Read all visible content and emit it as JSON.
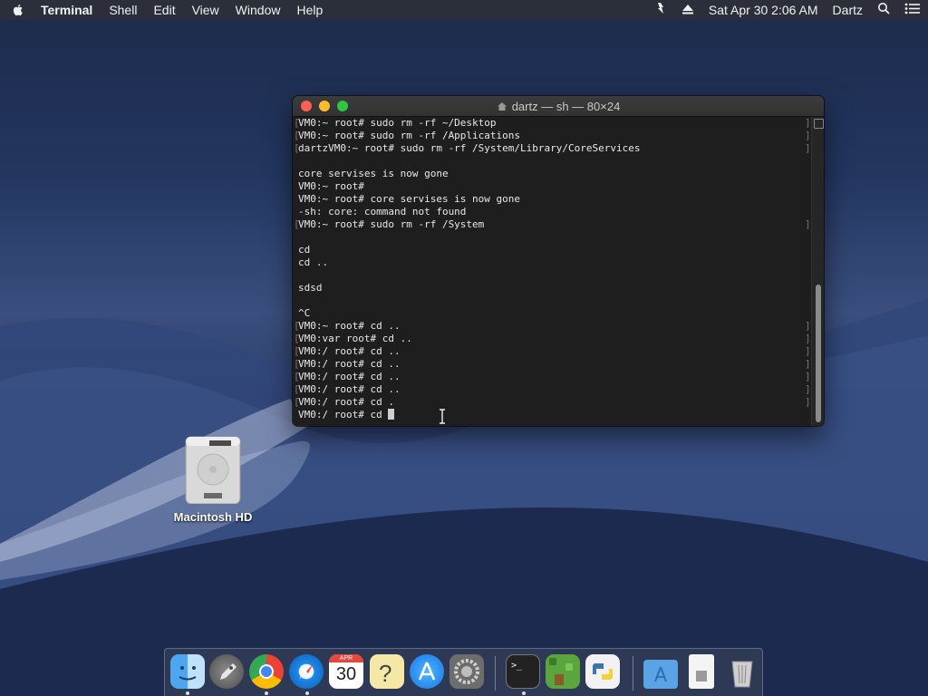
{
  "menubar": {
    "app_name": "Terminal",
    "menus": [
      "Shell",
      "Edit",
      "View",
      "Window",
      "Help"
    ],
    "clock": "Sat Apr 30  2:06 AM",
    "user": "Dartz"
  },
  "window": {
    "title": "dartz — sh — 80×24",
    "lines": [
      {
        "text": "VM0:~ root# sudo rm -rf ~/Desktop",
        "marks": true
      },
      {
        "text": "VM0:~ root# sudo rm -rf /Applications",
        "marks": true
      },
      {
        "text": "dartzVM0:~ root# sudo rm -rf /System/Library/CoreServices",
        "marks": true
      },
      {
        "text": "",
        "marks": false
      },
      {
        "text": "core servises is now gone",
        "marks": false
      },
      {
        "text": "VM0:~ root#",
        "marks": false
      },
      {
        "text": "VM0:~ root# core servises is now gone",
        "marks": false
      },
      {
        "text": "-sh: core: command not found",
        "marks": false
      },
      {
        "text": "VM0:~ root# sudo rm -rf /System",
        "marks": true
      },
      {
        "text": "",
        "marks": false
      },
      {
        "text": "cd",
        "marks": false
      },
      {
        "text": "cd ..",
        "marks": false
      },
      {
        "text": "",
        "marks": false
      },
      {
        "text": "sdsd",
        "marks": false
      },
      {
        "text": "",
        "marks": false
      },
      {
        "text": "^C",
        "marks": false
      },
      {
        "text": "VM0:~ root# cd ..",
        "marks": true
      },
      {
        "text": "VM0:var root# cd ..",
        "marks": true
      },
      {
        "text": "VM0:/ root# cd ..",
        "marks": true
      },
      {
        "text": "VM0:/ root# cd ..",
        "marks": true
      },
      {
        "text": "VM0:/ root# cd ..",
        "marks": true
      },
      {
        "text": "VM0:/ root# cd ..",
        "marks": true
      },
      {
        "text": "VM0:/ root# cd .",
        "marks": true
      }
    ],
    "prompt_line": "VM0:/ root# cd "
  },
  "desktop": {
    "hd_label": "Macintosh HD"
  },
  "dock": {
    "calendar_month": "APR",
    "calendar_day": "30",
    "items": [
      "finder-icon",
      "launchpad-icon",
      "chrome-icon",
      "safari-icon",
      "calendar-icon",
      "notes-icon",
      "app-store-icon",
      "system-preferences-icon",
      "terminal-icon",
      "minecraft-icon",
      "python-launcher-icon",
      "applications-folder-icon",
      "document-icon",
      "trash-icon"
    ]
  }
}
